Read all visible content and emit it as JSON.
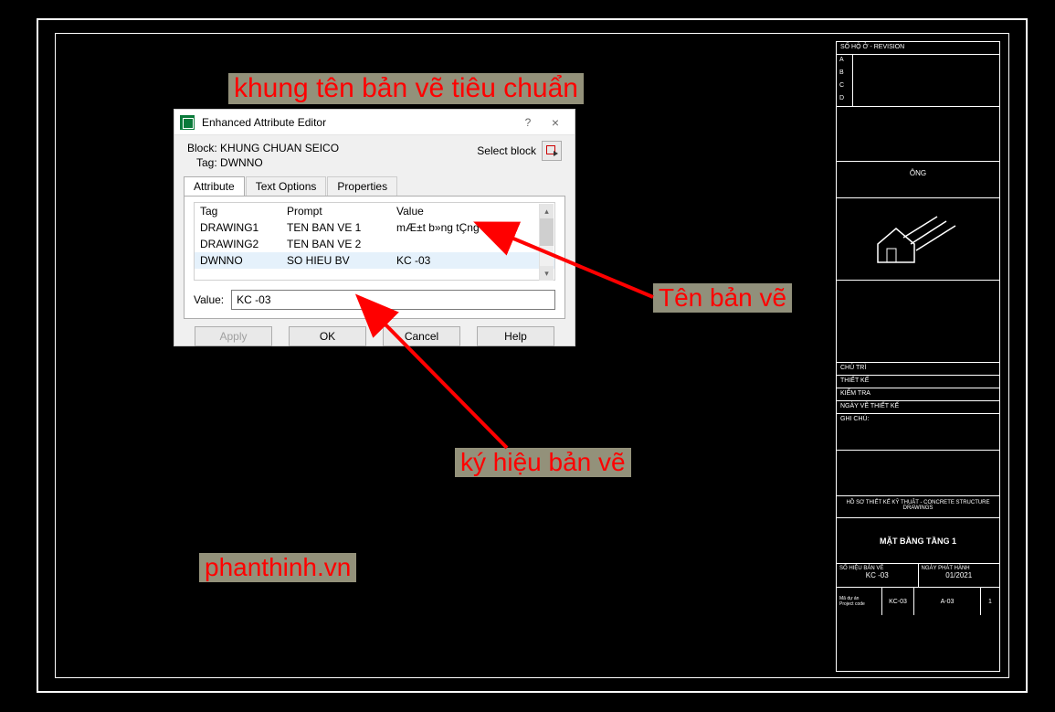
{
  "annotations": {
    "title": "khung tên bản vẽ tiêu chuẩn",
    "ten": "Tên bản vẽ",
    "ky": "ký hiệu bản vẽ",
    "url": "phanthinh.vn"
  },
  "dialog": {
    "title": "Enhanced Attribute Editor",
    "help": "?",
    "close": "×",
    "block_label": "Block:",
    "block_value": "KHUNG CHUAN SEICO",
    "tag_label": "Tag:",
    "tag_value": "DWNNO",
    "select_block": "Select block",
    "tabs": {
      "attribute": "Attribute",
      "text_options": "Text Options",
      "properties": "Properties"
    },
    "headers": {
      "tag": "Tag",
      "prompt": "Prompt",
      "value": "Value"
    },
    "rows": [
      {
        "tag": "DRAWING1",
        "prompt": "TEN BAN VE 1",
        "value": "mÆ±t b»ng tÇng 1"
      },
      {
        "tag": "DRAWING2",
        "prompt": "TEN BAN VE 2",
        "value": ""
      },
      {
        "tag": "DWNNO",
        "prompt": "SO HIEU BV",
        "value": "KC -03"
      }
    ],
    "value_label": "Value:",
    "value_input": "KC -03",
    "buttons": {
      "apply": "Apply",
      "ok": "OK",
      "cancel": "Cancel",
      "help": "Help"
    }
  },
  "titleblock": {
    "section1": "SỐ HỘ Ở - REVISION",
    "revcols": [
      "A",
      "B",
      "C",
      "D"
    ],
    "owner_label": "ÔNG",
    "rows": {
      "chutri": "CHỦ TRÌ",
      "thietke": "THIẾT KẾ",
      "kiemtra": "KIỂM TRA",
      "ngayve": "NGÀY VẼ THIẾT KẾ"
    },
    "ghichu": "GHI CHÚ:",
    "hoso": "HỒ SƠ THIẾT KẾ KỸ THUẬT - CONCRETE STRUCTURE DRAWINGS",
    "dwg_name": "MẶT BẰNG TẦNG 1",
    "bot": {
      "left_label": "SỐ HIỆU BẢN VẼ",
      "left_val": "KC -03",
      "right_label": "NGÀY PHÁT HÀNH",
      "right_val": "01/2021",
      "proj_label": "Mã dự án\nProject code",
      "proj_val": "KC-03",
      "mid": "A-03",
      "pg": "1"
    }
  }
}
